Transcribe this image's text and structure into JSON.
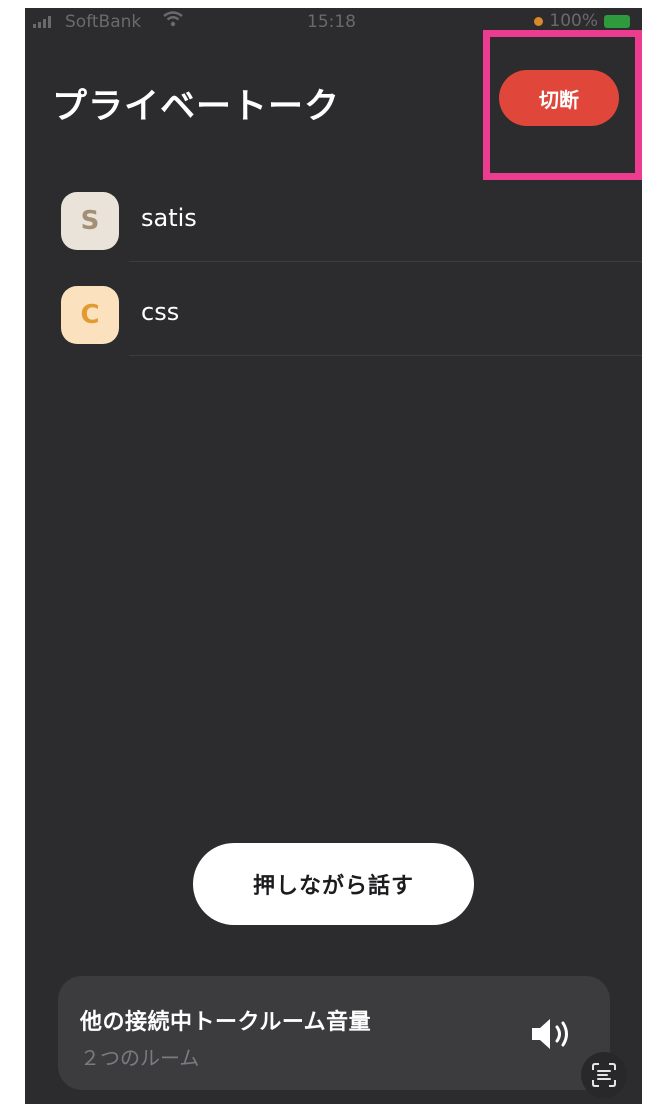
{
  "status_bar": {
    "carrier": "SoftBank",
    "time": "15:18",
    "battery": "100%"
  },
  "header": {
    "title": "プライベートーク",
    "disconnect_label": "切断"
  },
  "members": [
    {
      "initial": "S",
      "name": "satis",
      "avatar_bg": "#e9e3da",
      "avatar_fg": "#a38f74"
    },
    {
      "initial": "C",
      "name": "css",
      "avatar_bg": "#fbe1be",
      "avatar_fg": "#e49a33"
    }
  ],
  "talk_button": {
    "label": "押しながら話す"
  },
  "volume_panel": {
    "title": "他の接続中トークルーム音量",
    "subtitle": "２つのルーム",
    "icon": "speaker-icon"
  },
  "colors": {
    "background": "#2c2c2e",
    "disconnect": "#e0473a",
    "highlight": "#ec3c8f"
  }
}
